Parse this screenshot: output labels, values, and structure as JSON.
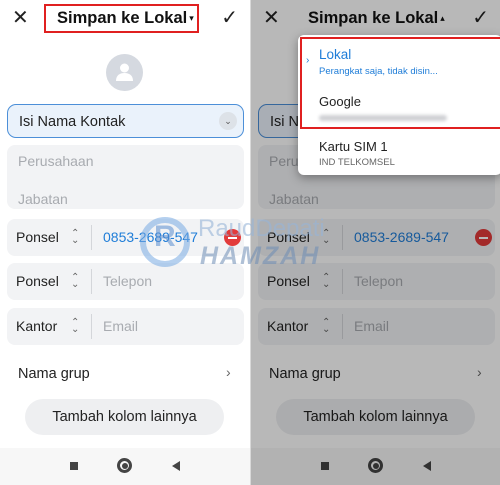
{
  "header": {
    "close_icon": "close-icon",
    "title": "Simpan ke Lokal",
    "caret_left": "▾",
    "caret_right": "▴",
    "check_icon": "check-icon"
  },
  "form": {
    "name_placeholder": "Isi Nama Kontak",
    "company_placeholder": "Perusahaan",
    "title_placeholder": "Jabatan",
    "phones": [
      {
        "label": "Ponsel",
        "value": "0853-2689-547"
      },
      {
        "label": "Ponsel",
        "placeholder": "Telepon"
      },
      {
        "label": "Kantor",
        "placeholder": "Email"
      }
    ],
    "group_label": "Nama grup",
    "chevron_right": "›",
    "more_fields_button": "Tambah kolom lainnya"
  },
  "dropdown": {
    "items": [
      {
        "title": "Lokal",
        "subtitle": "Perangkat saja, tidak disin...",
        "selected": true
      },
      {
        "title": "Google",
        "subtitle": ""
      },
      {
        "title": "Kartu SIM 1",
        "subtitle": "IND TELKOMSEL"
      }
    ]
  },
  "watermark": {
    "line1": "RaudDepati",
    "line2": "HAMZAH",
    "monogram": "R"
  },
  "colors": {
    "accent": "#1f7dd8",
    "highlight": "#e02020",
    "delete": "#e23b3b"
  },
  "updown_glyph": "⌃⌄"
}
